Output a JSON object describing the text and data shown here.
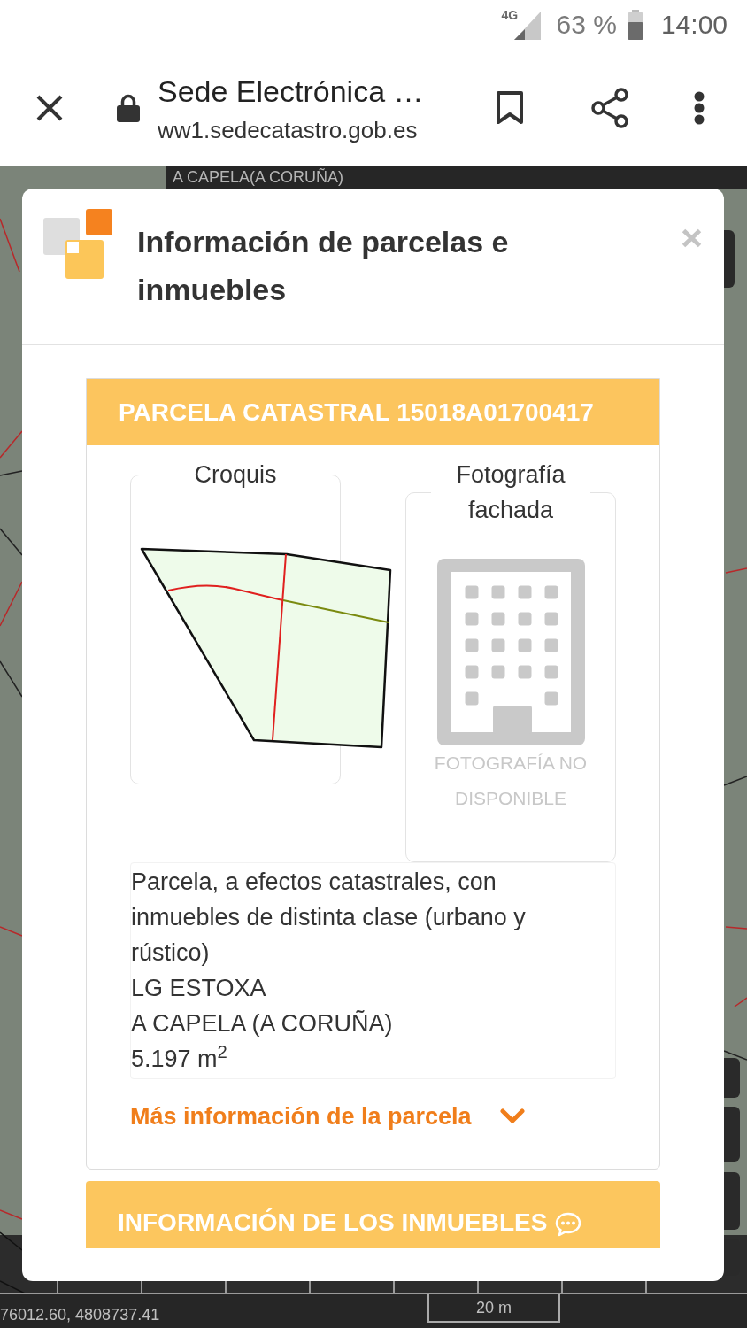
{
  "status_bar": {
    "network": "4G",
    "battery": "63 %",
    "time": "14:00"
  },
  "browser_bar": {
    "title": "Sede Electrónica …",
    "url": "ww1.sedecatastro.gob.es"
  },
  "map": {
    "location_label": "A CAPELA(A CORUÑA)",
    "coordinates": "76012.60, 4808737.41",
    "scale": "20 m"
  },
  "dialog": {
    "title": "Información de parcelas e inmuebles",
    "parcel": {
      "header": "PARCELA CATASTRAL 15018A01700417",
      "sketch_title": "Croquis",
      "photo_title": "Fotografía fachada",
      "photo_missing": "FOTOGRAFÍA NO DISPONIBLE",
      "description": "Parcela, a efectos catastrales, con inmuebles de distinta clase (urbano y rústico)",
      "locality": "LG ESTOXA",
      "municipality": "A CAPELA (A CORUÑA)",
      "area": "5.197 m$^{2}$",
      "more_info": {
        "label": "Más información de la parcela",
        "expanded": false
      }
    },
    "properties_section": {
      "header": "INFORMACIÓN DE LOS INMUEBLES"
    }
  }
}
